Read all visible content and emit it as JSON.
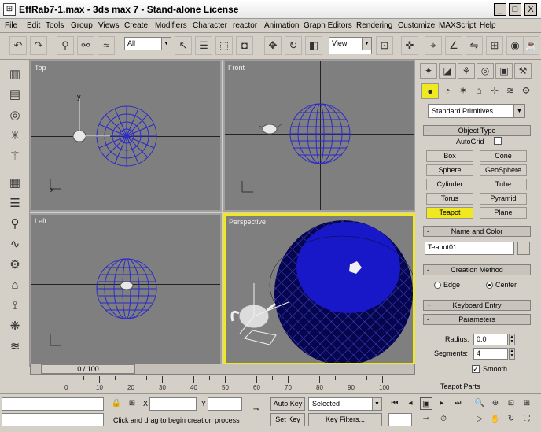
{
  "window": {
    "title": "EffRab7-1.max - 3ds max 7 - Stand-alone License",
    "icon": "3ds-max-app-icon",
    "minimize": "_",
    "maximize": "□",
    "close": "X"
  },
  "menu": [
    "File",
    "Edit",
    "Tools",
    "Group",
    "Views",
    "Create",
    "Modifiers",
    "Character",
    "reactor",
    "Animation",
    "Graph Editors",
    "Rendering",
    "Customize",
    "MAXScript",
    "Help"
  ],
  "toolbar": {
    "selection_filter": "All",
    "ref_coord": "View"
  },
  "viewports": {
    "top": {
      "label": "Top",
      "axis_x": "x",
      "axis_y": "y"
    },
    "front": {
      "label": "Front"
    },
    "left": {
      "label": "Left"
    },
    "perspective": {
      "label": "Perspective"
    }
  },
  "command_panel": {
    "category_dropdown": "Standard Primitives",
    "rollouts": {
      "object_type": "Object Type",
      "name_and_color": "Name and Color",
      "creation_method": "Creation Method",
      "keyboard_entry": "Keyboard Entry",
      "parameters": "Parameters",
      "teapot_parts": "Teapot Parts"
    },
    "autogrid_label": "AutoGrid",
    "object_buttons": [
      "Box",
      "Cone",
      "Sphere",
      "GeoSphere",
      "Cylinder",
      "Tube",
      "Torus",
      "Pyramid",
      "Teapot",
      "Plane"
    ],
    "selected_object": "Teapot",
    "object_name": "Teapot01",
    "creation": {
      "edge_label": "Edge",
      "center_label": "Center",
      "selected": "Center"
    },
    "params": {
      "radius_label": "Radius:",
      "radius_value": "0.0",
      "segments_label": "Segments:",
      "segments_value": "4",
      "smooth_label": "Smooth",
      "smooth_checked": true
    },
    "colors": {
      "selected_button": "#f0e820",
      "sphere_wire": "#2a2ac8"
    }
  },
  "timeline": {
    "frame_display": "0 / 100",
    "ruler_labels": [
      "0",
      "10",
      "20",
      "30",
      "40",
      "50",
      "60",
      "70",
      "80",
      "90",
      "100"
    ]
  },
  "status": {
    "prompt": "Click and drag to begin creation process",
    "x_label": "X",
    "y_label": "Y",
    "auto_key": "Auto Key",
    "set_key": "Set Key",
    "selected_dropdown": "Selected",
    "key_filters": "Key Filters..."
  }
}
